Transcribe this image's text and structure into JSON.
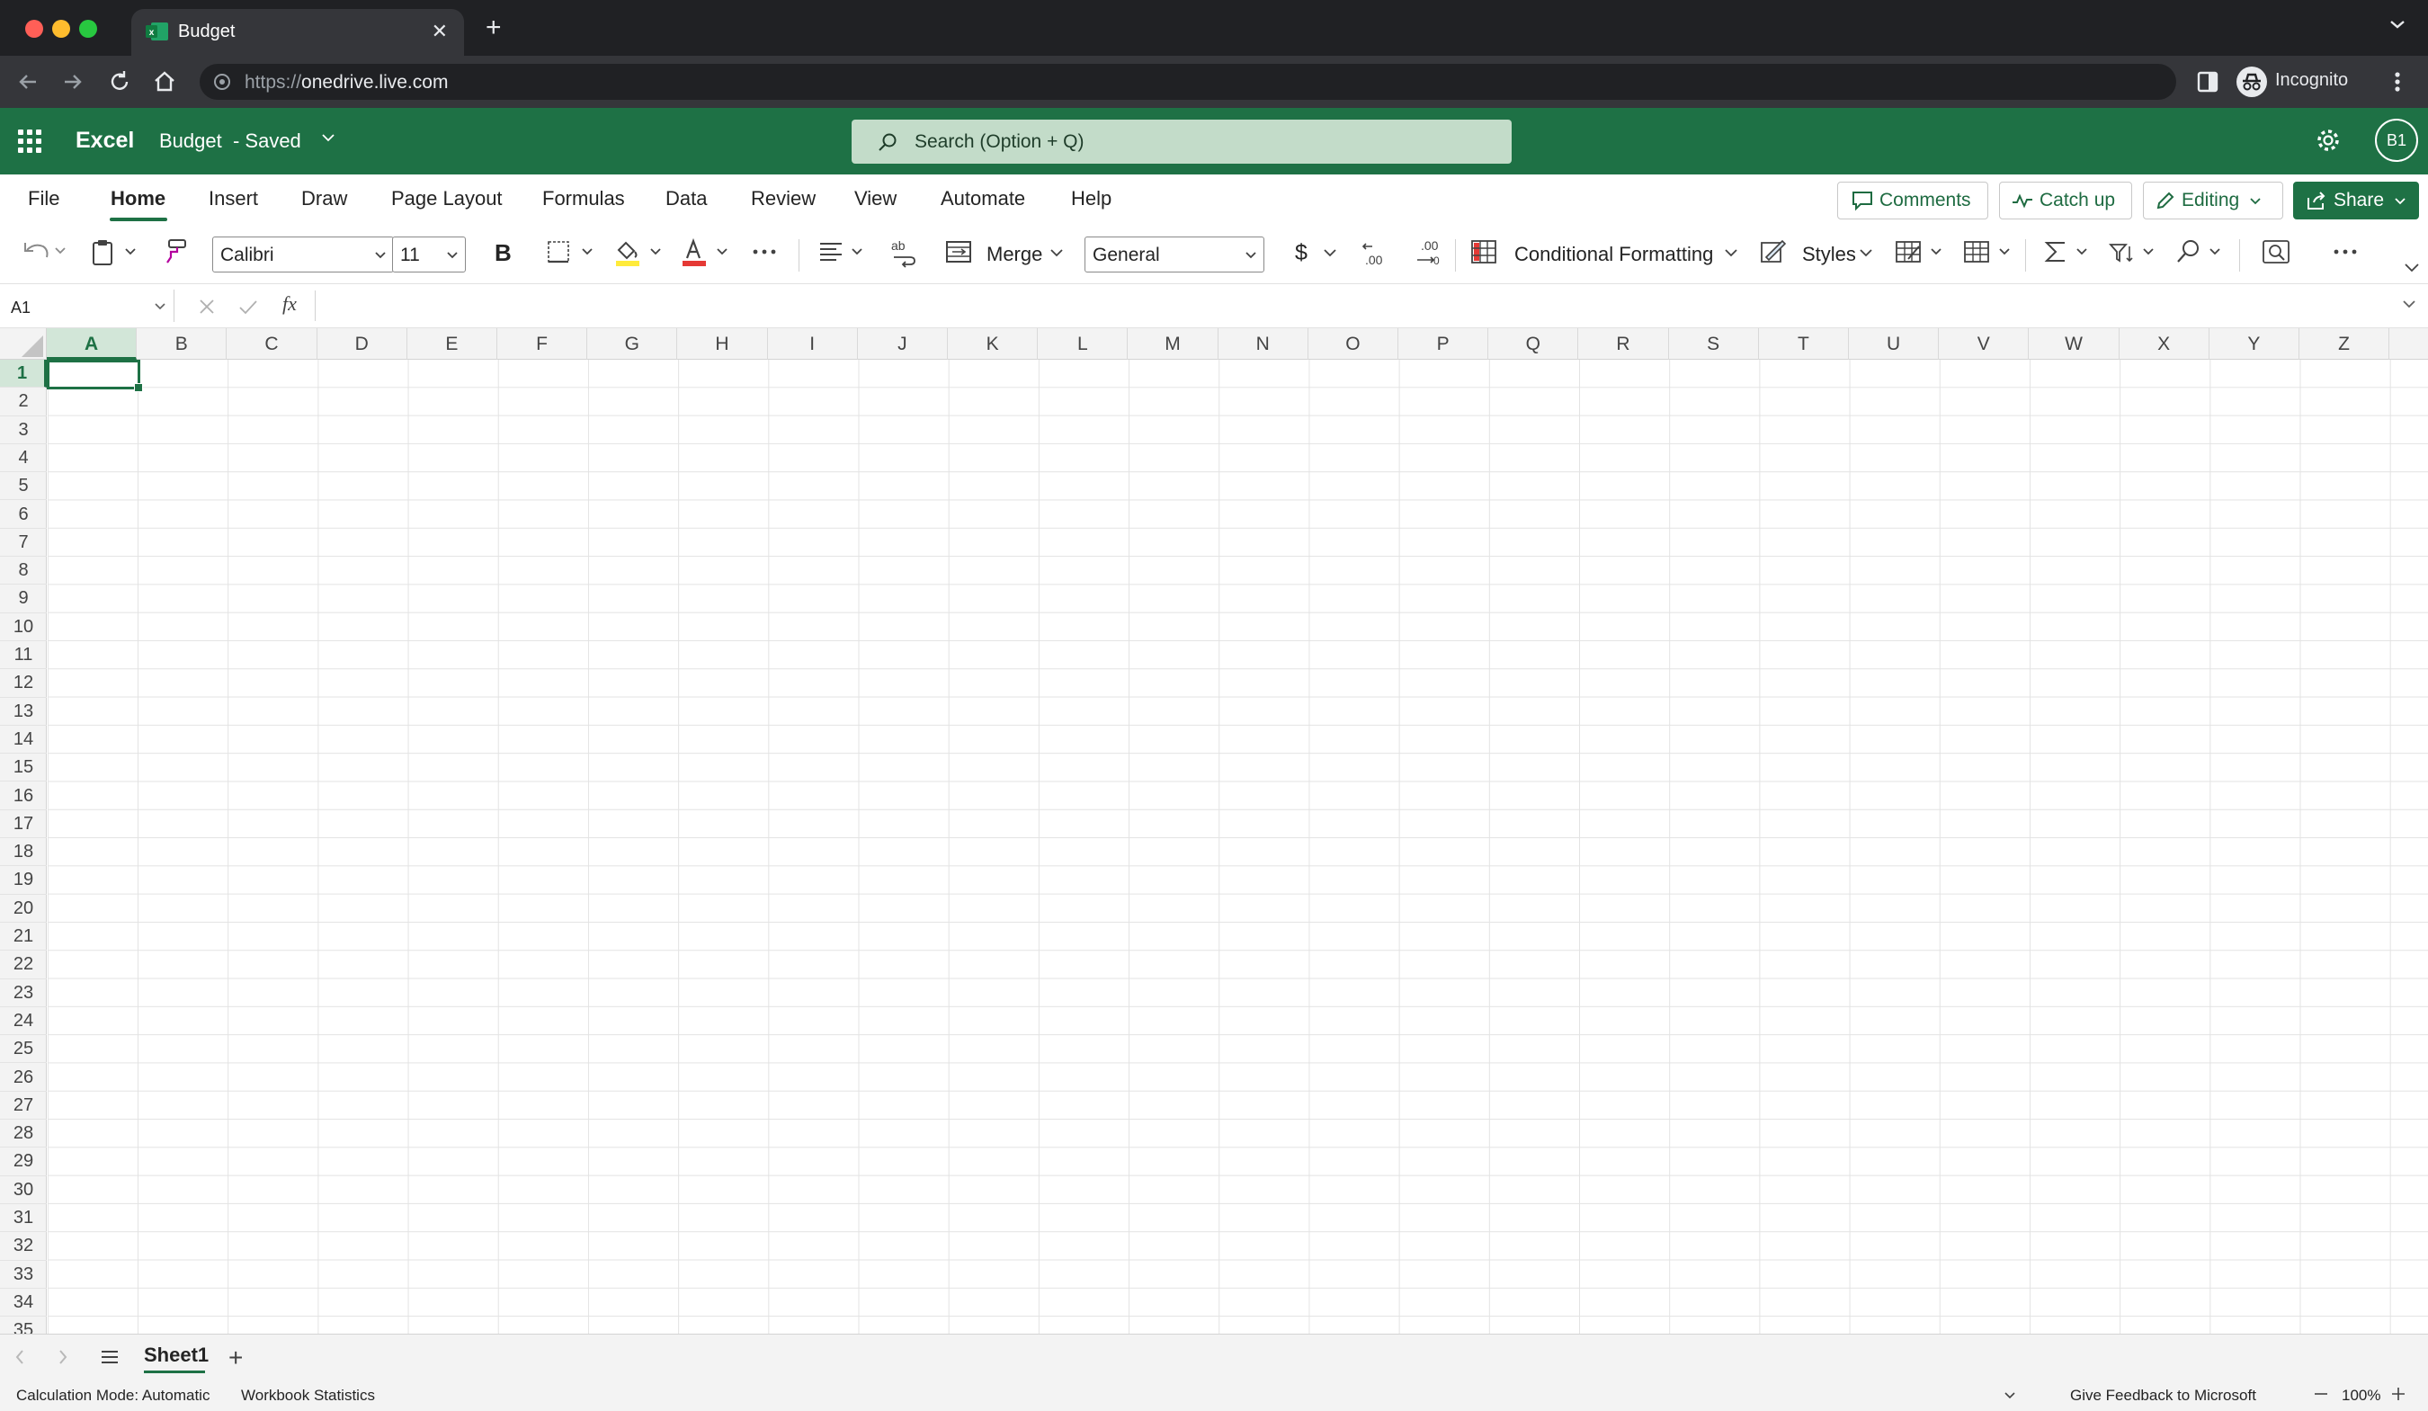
{
  "browser": {
    "tab_title": "Budget",
    "url_scheme": "https://",
    "url_host": "onedrive.live.com",
    "profile_label": "Incognito"
  },
  "excel": {
    "app_name": "Excel",
    "doc_name": "Budget",
    "doc_status": "-  Saved",
    "search_placeholder": "Search (Option + Q)",
    "avatar_initials": "B1",
    "brand_color": "#1e7145"
  },
  "ribbon": {
    "tabs": [
      "File",
      "Home",
      "Insert",
      "Draw",
      "Page Layout",
      "Formulas",
      "Data",
      "Review",
      "View",
      "Automate",
      "Help"
    ],
    "active_tab": "Home",
    "comments_label": "Comments",
    "catchup_label": "Catch up",
    "editing_label": "Editing",
    "share_label": "Share"
  },
  "toolbar": {
    "font_name": "Calibri",
    "font_size": "11",
    "bold_label": "B",
    "merge_label": "Merge",
    "number_format": "General",
    "currency_symbol": "$",
    "conditional_formatting_label": "Conditional Formatting",
    "styles_label": "Styles",
    "fx_label": "fx"
  },
  "formula_bar": {
    "name_box": "A1",
    "formula": ""
  },
  "grid": {
    "columns": [
      "A",
      "B",
      "C",
      "D",
      "E",
      "F",
      "G",
      "H",
      "I",
      "J",
      "K",
      "L",
      "M",
      "N",
      "O",
      "P",
      "Q",
      "R",
      "S",
      "T",
      "U",
      "V",
      "W",
      "X",
      "Y",
      "Z"
    ],
    "rows": [
      "1",
      "2",
      "3",
      "4",
      "5",
      "6",
      "7",
      "8",
      "9",
      "10",
      "11",
      "12",
      "13",
      "14",
      "15",
      "16",
      "17",
      "18",
      "19",
      "20",
      "21",
      "22",
      "23",
      "24",
      "25",
      "26",
      "27",
      "28",
      "29",
      "30",
      "31",
      "32",
      "33",
      "34",
      "35"
    ],
    "selected_cell": "A1"
  },
  "sheets": {
    "tabs": [
      "Sheet1"
    ]
  },
  "status": {
    "calc_mode": "Calculation Mode: Automatic",
    "workbook_stats": "Workbook Statistics",
    "feedback": "Give Feedback to Microsoft",
    "zoom": "100%"
  }
}
